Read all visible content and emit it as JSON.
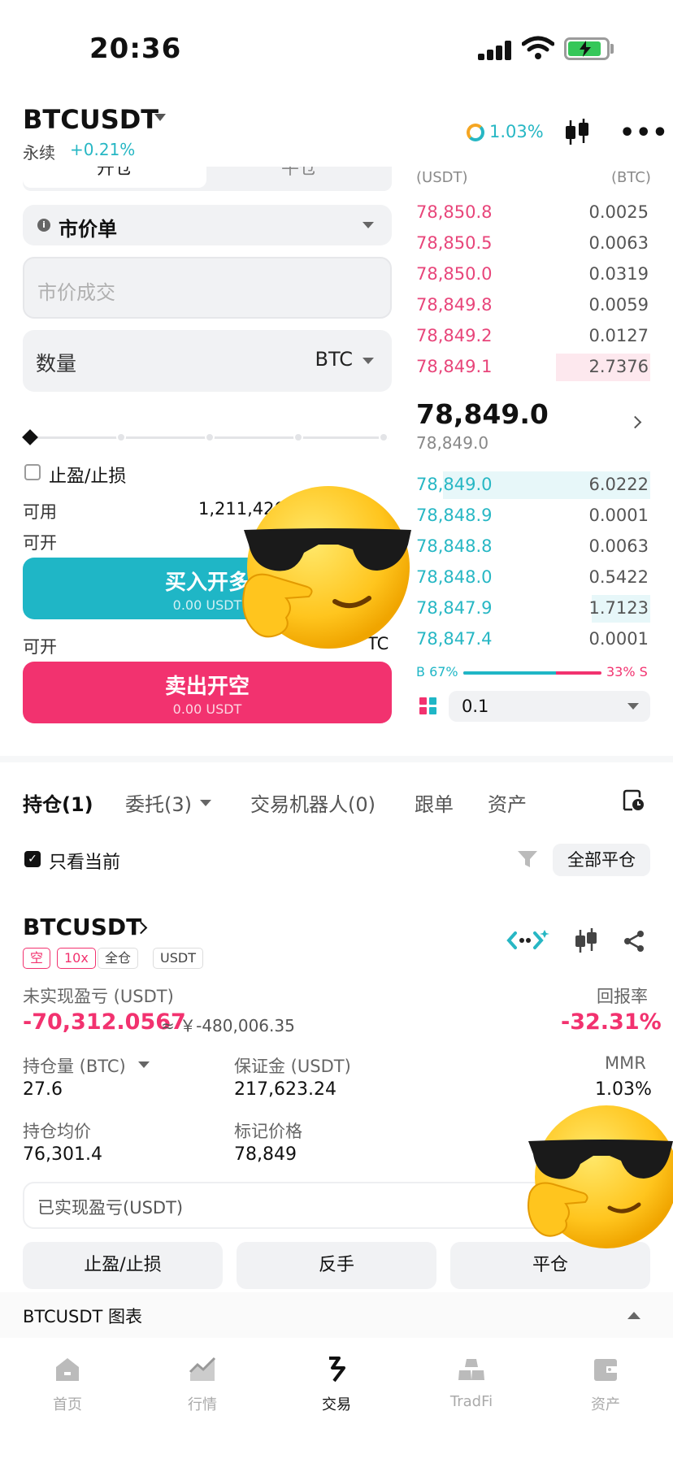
{
  "status_bar": {
    "time": "20:36"
  },
  "header": {
    "pair": "BTCUSDT",
    "contract_type": "永续",
    "change": "+0.21%",
    "risk_rate": "1.03%"
  },
  "order_form": {
    "tab_open": "开仓",
    "tab_close": "平仓",
    "order_type": "市价单",
    "price_placeholder": "市价成交",
    "qty_label": "数量",
    "qty_unit": "BTC",
    "tpsl_label": "止盈/止损",
    "available_label": "可用",
    "available_value": "1,211,420",
    "open_label": "可开",
    "open_label_2": "可开",
    "open_unit_tail": "TC",
    "buy": {
      "title": "买入开多",
      "sub": "0.00 USDT"
    },
    "sell": {
      "title": "卖出开空",
      "sub": "0.00 USDT"
    }
  },
  "order_book": {
    "head_price": "(USDT)",
    "head_qty": "(BTC)",
    "asks": [
      {
        "price": "78,850.8",
        "qty": "0.0025"
      },
      {
        "price": "78,850.5",
        "qty": "0.0063"
      },
      {
        "price": "78,850.0",
        "qty": "0.0319"
      },
      {
        "price": "78,849.8",
        "qty": "0.0059"
      },
      {
        "price": "78,849.2",
        "qty": "0.0127"
      },
      {
        "price": "78,849.1",
        "qty": "2.7376",
        "depth": 0.4
      }
    ],
    "last_price": "78,849.0",
    "mark_price": "78,849.0",
    "bids": [
      {
        "price": "78,849.0",
        "qty": "6.0222",
        "depth": 0.88
      },
      {
        "price": "78,848.9",
        "qty": "0.0001"
      },
      {
        "price": "78,848.8",
        "qty": "0.0063"
      },
      {
        "price": "78,848.0",
        "qty": "0.5422"
      },
      {
        "price": "78,847.9",
        "qty": "1.7123",
        "depth": 0.25
      },
      {
        "price": "78,847.4",
        "qty": "0.0001"
      }
    ],
    "buy_ratio_label": "B 67%",
    "sell_ratio_label": "33% S",
    "buy_ratio": 0.67,
    "depth_step": "0.1"
  },
  "positions_tabs": [
    "持仓(1)",
    "委托(3)",
    "交易机器人(0)",
    "跟单",
    "资产"
  ],
  "filter": {
    "only_current": "只看当前",
    "close_all": "全部平仓"
  },
  "position": {
    "symbol": "BTCUSDT",
    "tags": [
      "空",
      "10x",
      "全仓",
      "USDT"
    ],
    "upnl_label": "未实现盈亏 (USDT)",
    "upnl_value": "-70,312.0567",
    "upnl_cny": "≈ ￥-480,006.35",
    "roe_label": "回报率",
    "roe_value": "-32.31%",
    "size_label": "持仓量 (BTC)",
    "size_value": "27.6",
    "margin_label": "保证金 (USDT)",
    "margin_value": "217,623.24",
    "mmr_label": "MMR",
    "mmr_value": "1.03%",
    "entry_label": "持仓均价",
    "entry_value": "76,301.4",
    "mark_label": "标记价格",
    "mark_value": "78,849",
    "realized_placeholder": "已实现盈亏(USDT)",
    "actions": [
      "止盈/止损",
      "反手",
      "平仓"
    ]
  },
  "chart_bar": {
    "title": "BTCUSDT  图表"
  },
  "bottom_nav": [
    {
      "label": "首页",
      "icon": "home-icon"
    },
    {
      "label": "行情",
      "icon": "chart-icon"
    },
    {
      "label": "交易",
      "icon": "trade-icon"
    },
    {
      "label": "TradFi",
      "icon": "gold-bars-icon"
    },
    {
      "label": "资产",
      "icon": "wallet-icon"
    }
  ],
  "colors": {
    "buy": "#1fb6c6",
    "sell": "#f2326f",
    "ask_text": "#e8457a",
    "bid_text": "#27b7c4"
  }
}
